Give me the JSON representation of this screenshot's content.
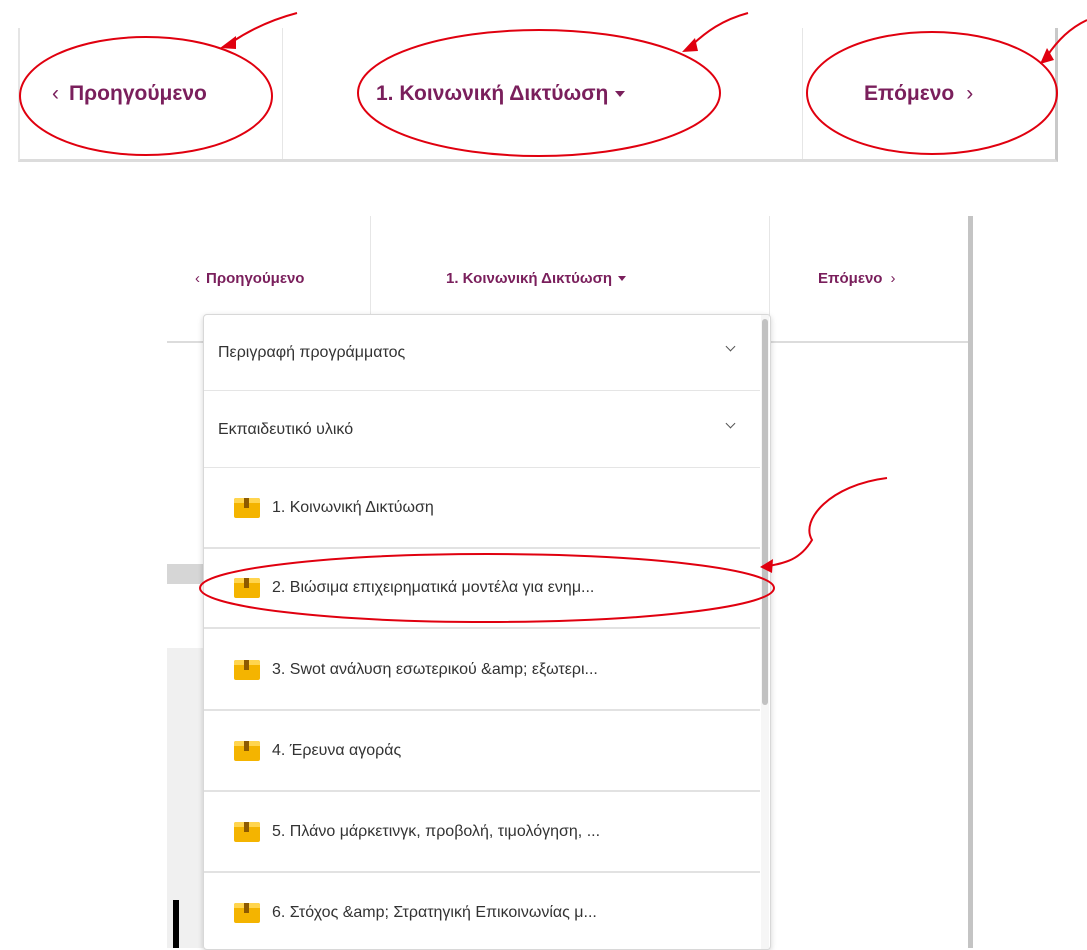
{
  "nav": {
    "prev_label": "Προηγούμενο",
    "prev_chevron": "‹",
    "current_label": "1. Κοινωνική Δικτύωση",
    "next_label": "Επόμενο",
    "next_chevron": "›"
  },
  "dropdown": {
    "sections": [
      {
        "label": "Περιγραφή προγράμματος",
        "icon": "chevron-down-icon"
      },
      {
        "label": "Εκπαιδευτικό υλικό",
        "icon": "chevron-down-icon"
      }
    ],
    "items": [
      {
        "label": "1. Κοινωνική Δικτύωση",
        "icon": "package-icon"
      },
      {
        "label": "2. Βιώσιμα επιχειρηματικά μοντέλα για ενημ...",
        "icon": "package-icon"
      },
      {
        "label": "3. Swot ανάλυση εσωτερικού &amp; εξωτερι...",
        "icon": "package-icon"
      },
      {
        "label": "4. Έρευνα αγοράς",
        "icon": "package-icon"
      },
      {
        "label": "5. Πλάνο μάρκετινγκ, προβολή, τιμολόγηση, ...",
        "icon": "package-icon"
      },
      {
        "label": "6. Στόχος &amp; Στρατηγική Επικοινωνίας μ...",
        "icon": "package-icon"
      }
    ]
  },
  "colors": {
    "accent": "#7a1f5c",
    "annotation": "#e0000f",
    "icon": "#f4b400"
  }
}
